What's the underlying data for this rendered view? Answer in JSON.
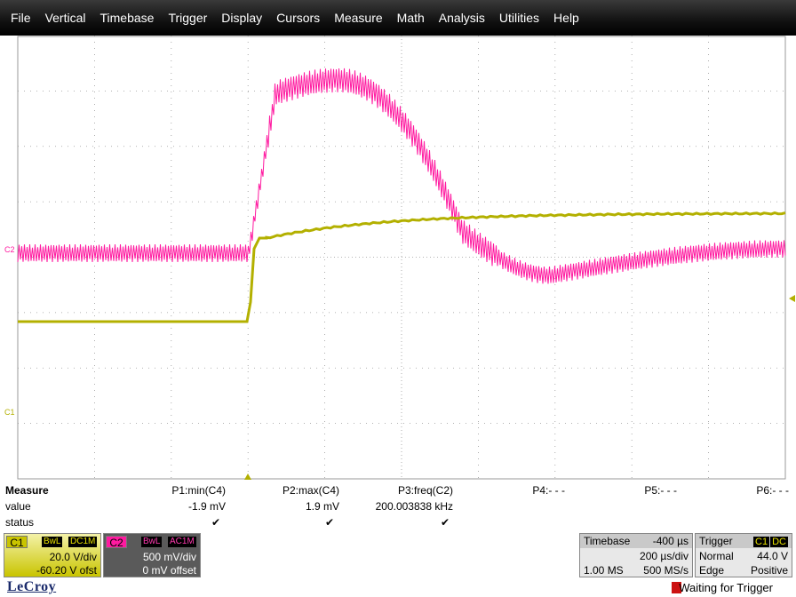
{
  "menu": [
    "File",
    "Vertical",
    "Timebase",
    "Trigger",
    "Display",
    "Cursors",
    "Measure",
    "Math",
    "Analysis",
    "Utilities",
    "Help"
  ],
  "colors": {
    "c1": "#b3b000",
    "c2": "#ff1aa0",
    "grid": "#9a9a9a",
    "menubar": "#111111"
  },
  "markers": {
    "c1": "C1",
    "c2": "C2"
  },
  "measure": {
    "title": "Measure",
    "row_value": "value",
    "row_status": "status",
    "params": [
      {
        "name": "P1:min(C4)",
        "value": "-1.9 mV",
        "status": "✔"
      },
      {
        "name": "P2:max(C4)",
        "value": "1.9 mV",
        "status": "✔"
      },
      {
        "name": "P3:freq(C2)",
        "value": "200.003838 kHz",
        "status": "✔"
      },
      {
        "name": "P4:- - -",
        "value": "",
        "status": ""
      },
      {
        "name": "P5:- - -",
        "value": "",
        "status": ""
      },
      {
        "name": "P6:- - -",
        "value": "",
        "status": ""
      }
    ]
  },
  "channels": {
    "c1": {
      "tag": "C1",
      "badge1": "BwL",
      "badge2": "DC1M",
      "vdiv": "20.0 V/div",
      "offset": "-60.20 V ofst"
    },
    "c2": {
      "tag": "C2",
      "badge1": "BwL",
      "badge2": "AC1M",
      "vdiv": "500 mV/div",
      "offset": "0 mV offset"
    }
  },
  "timebase": {
    "label": "Timebase",
    "delay": "-400 µs",
    "tdiv": "200 µs/div",
    "samples": "1.00 MS",
    "rate": "500 MS/s"
  },
  "trigger": {
    "label": "Trigger",
    "source_badge": "C1",
    "coupling_badge": "DC",
    "mode": "Normal",
    "level": "44.0 V",
    "type": "Edge",
    "slope": "Positive"
  },
  "logo": "LeCroy",
  "status": "Waiting for Trigger"
}
